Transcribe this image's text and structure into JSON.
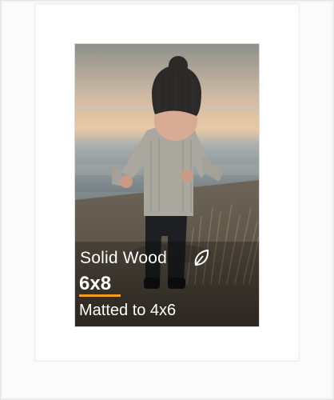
{
  "product": {
    "material_label": "Solid Wood",
    "material_icon": "leaf-icon",
    "size_label": "6x8",
    "matted_label": "Matted to 4x6",
    "accent_color": "#f0a020",
    "frame_color": "#ffffff"
  }
}
